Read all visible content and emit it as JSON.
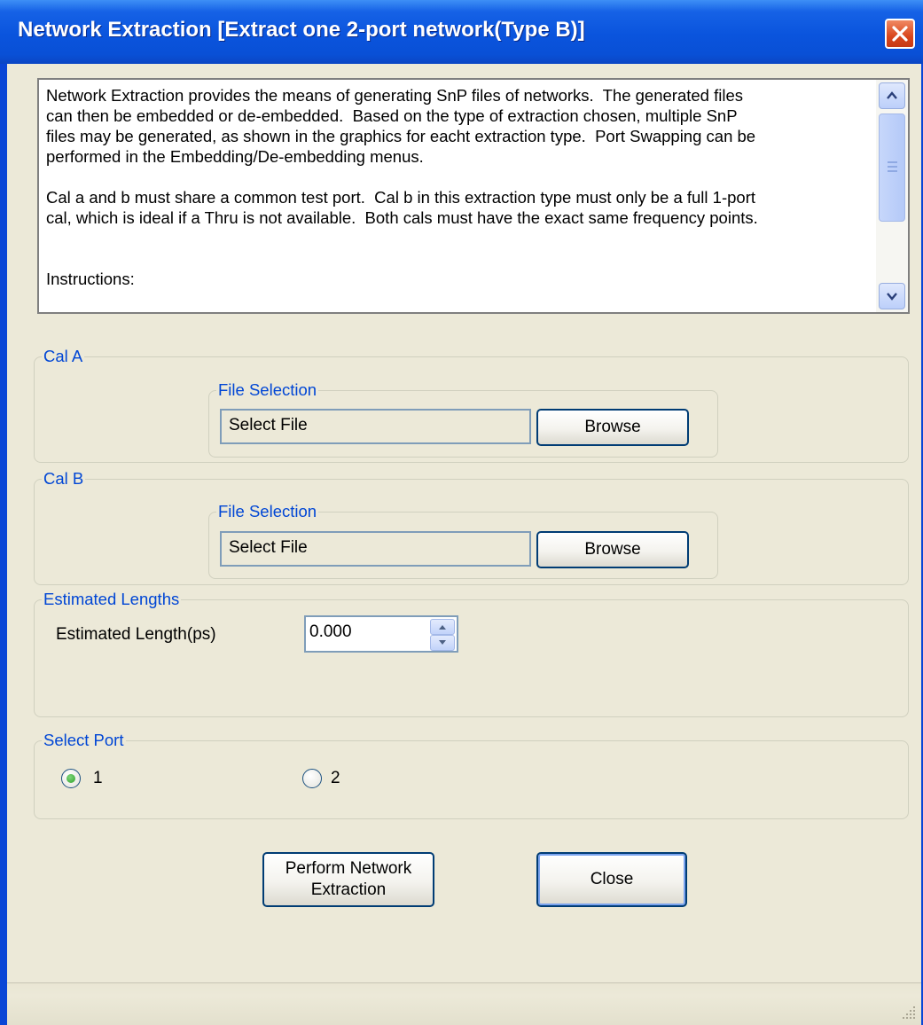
{
  "window": {
    "title": "Network Extraction [Extract one 2-port network(Type B)]"
  },
  "description": {
    "text": "Network Extraction provides the means of generating SnP files of networks.  The generated files\ncan then be embedded or de-embedded.  Based on the type of extraction chosen, multiple SnP\nfiles may be generated, as shown in the graphics for eacht extraction type.  Port Swapping can be\nperformed in the Embedding/De-embedding menus.\n\nCal a and b must share a common test port.  Cal b in this extraction type must only be a full 1-port\ncal, which is ideal if a Thru is not available.  Both cals must have the exact same frequency points.\n\n\nInstructions:"
  },
  "cal_a": {
    "legend": "Cal A",
    "file_selection_legend": "File Selection",
    "file_value": "Select File",
    "browse_label": "Browse"
  },
  "cal_b": {
    "legend": "Cal B",
    "file_selection_legend": "File Selection",
    "file_value": "Select File",
    "browse_label": "Browse"
  },
  "estimated_lengths": {
    "legend": "Estimated Lengths",
    "label": "Estimated Length(ps)",
    "value": "0.000"
  },
  "select_port": {
    "legend": "Select Port",
    "options": [
      {
        "label": "1",
        "selected": true
      },
      {
        "label": "2",
        "selected": false
      }
    ]
  },
  "actions": {
    "perform_line1": "Perform Network",
    "perform_line2": "Extraction",
    "close_label": "Close"
  },
  "colors": {
    "title_bar": "#0a54dd",
    "group_legend": "#0046d5",
    "window_bg": "#ece9d8"
  }
}
